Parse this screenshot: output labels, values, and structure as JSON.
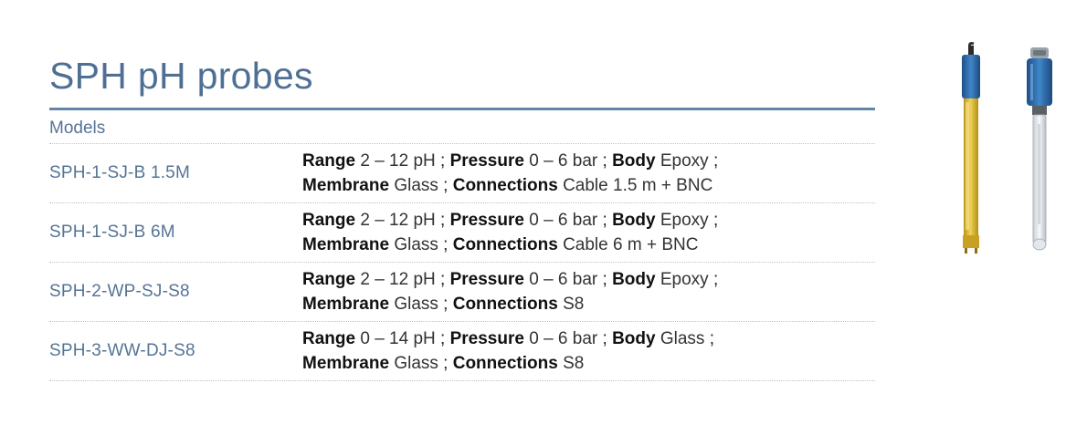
{
  "header": {
    "title": "SPH pH probes"
  },
  "table": {
    "section_label": "Models",
    "rows": [
      {
        "model": "SPH-1-SJ-B 1.5M",
        "range_label": "Range",
        "range_value": "2 – 12 pH",
        "pressure_label": "Pressure",
        "pressure_value": "0 – 6 bar",
        "body_label": "Body",
        "body_value": "Epoxy",
        "membrane_label": "Membrane",
        "membrane_value": "Glass",
        "connections_label": "Connections",
        "connections_value": "Cable 1.5 m + BNC"
      },
      {
        "model": "SPH-1-SJ-B 6M",
        "range_label": "Range",
        "range_value": "2 – 12 pH",
        "pressure_label": "Pressure",
        "pressure_value": "0 – 6 bar",
        "body_label": "Body",
        "body_value": "Epoxy",
        "membrane_label": "Membrane",
        "membrane_value": "Glass",
        "connections_label": "Connections",
        "connections_value": "Cable 6 m + BNC"
      },
      {
        "model": "SPH-2-WP-SJ-S8",
        "range_label": "Range",
        "range_value": "2 – 12 pH",
        "pressure_label": "Pressure",
        "pressure_value": "0 – 6 bar",
        "body_label": "Body",
        "body_value": "Epoxy",
        "membrane_label": "Membrane",
        "membrane_value": "Glass",
        "connections_label": "Connections",
        "connections_value": "S8"
      },
      {
        "model": "SPH-3-WW-DJ-S8",
        "range_label": "Range",
        "range_value": "0 – 14 pH",
        "pressure_label": "Pressure",
        "pressure_value": "0 – 6 bar",
        "body_label": "Body",
        "body_value": "Glass",
        "membrane_label": "Membrane",
        "membrane_value": "Glass",
        "connections_label": "Connections",
        "connections_value": "S8"
      }
    ]
  },
  "colors": {
    "heading_blue": "#4f7093",
    "rule_blue": "#6386a8",
    "probe_epoxy_yellow": "#d8b431",
    "probe_cap_blue": "#2f6fae"
  },
  "images": {
    "probe_1_icon": "ph-probe-epoxy-icon",
    "probe_2_icon": "ph-probe-glass-icon"
  }
}
